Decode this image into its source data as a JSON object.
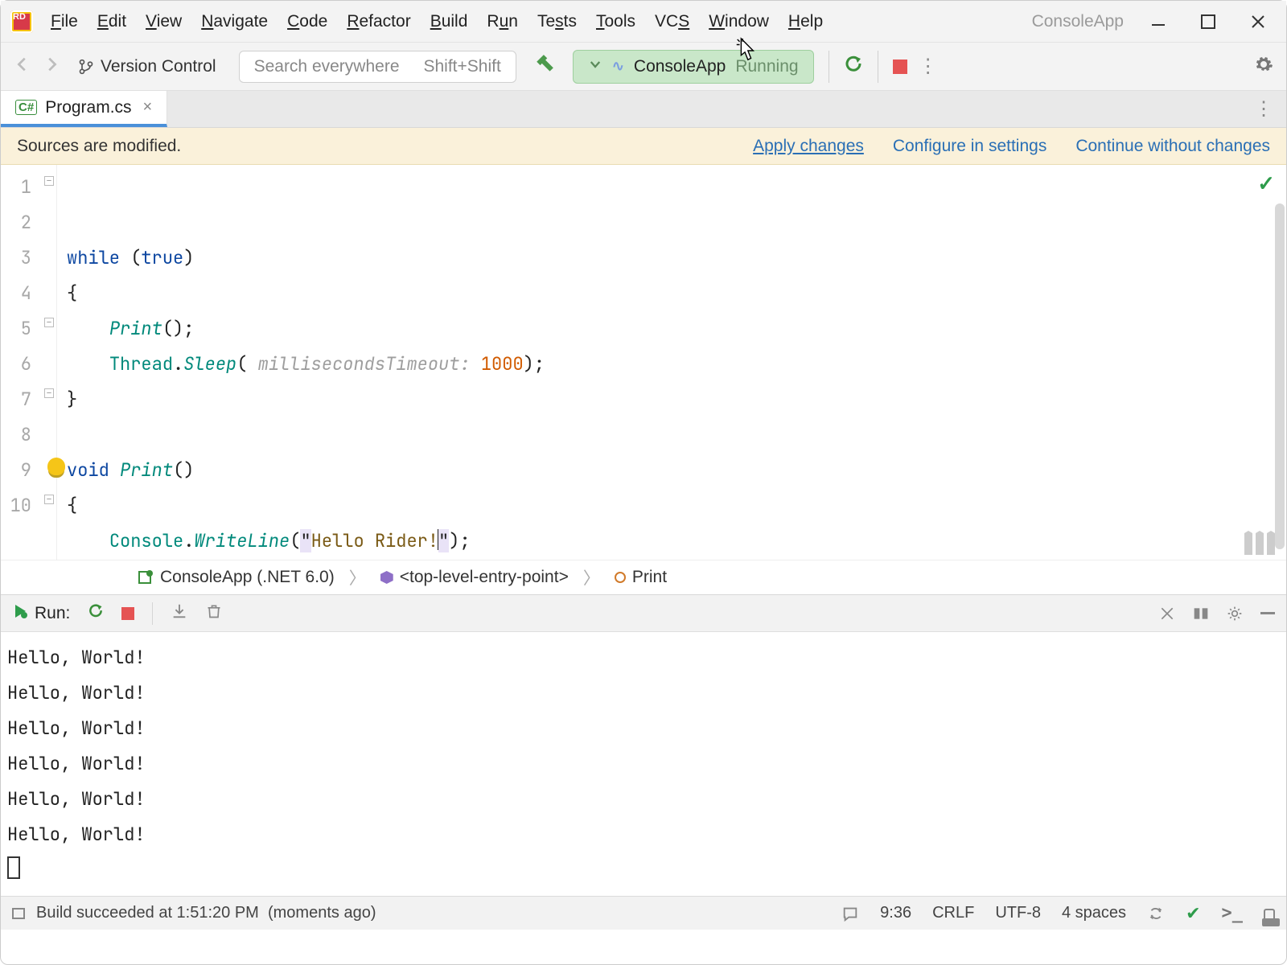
{
  "menubar": {
    "items": [
      "File",
      "Edit",
      "View",
      "Navigate",
      "Code",
      "Refactor",
      "Build",
      "Run",
      "Tests",
      "Tools",
      "VCS",
      "Window",
      "Help"
    ],
    "project": "ConsoleApp"
  },
  "toolbar": {
    "branch": "Version Control",
    "search_placeholder": "Search everywhere",
    "search_shortcut": "Shift+Shift",
    "run_config": {
      "name": "ConsoleApp",
      "status": "Running"
    }
  },
  "tabs": [
    {
      "icon": "C#",
      "name": "Program.cs"
    }
  ],
  "notification": {
    "message": "Sources are modified.",
    "actions": [
      "Apply changes",
      "Configure in settings",
      "Continue without changes"
    ]
  },
  "editor": {
    "lines": [
      {
        "n": 1
      },
      {
        "n": 2
      },
      {
        "n": 3
      },
      {
        "n": 4
      },
      {
        "n": 5
      },
      {
        "n": 6
      },
      {
        "n": 7
      },
      {
        "n": 8
      },
      {
        "n": 9
      },
      {
        "n": 10
      }
    ],
    "code": {
      "kw_while": "while",
      "kw_true": "true",
      "print_call": "Print",
      "thread": "Thread",
      "sleep": "Sleep",
      "hint": "millisecondsTimeout:",
      "num": "1000",
      "kw_void": "void",
      "print_def": "Print",
      "console": "Console",
      "writeline": "WriteLine",
      "str": "Hello Rider!"
    }
  },
  "breadcrumb": {
    "items": [
      "ConsoleApp (.NET 6.0)",
      "<top-level-entry-point>",
      "Print"
    ]
  },
  "run": {
    "title": "Run:",
    "output_line": "Hello, World!",
    "repeat": 6
  },
  "statusbar": {
    "build_msg": "Build succeeded at 1:51:20 PM",
    "build_age": "(moments ago)",
    "pos": "9:36",
    "eol": "CRLF",
    "encoding": "UTF-8",
    "indent": "4 spaces"
  }
}
